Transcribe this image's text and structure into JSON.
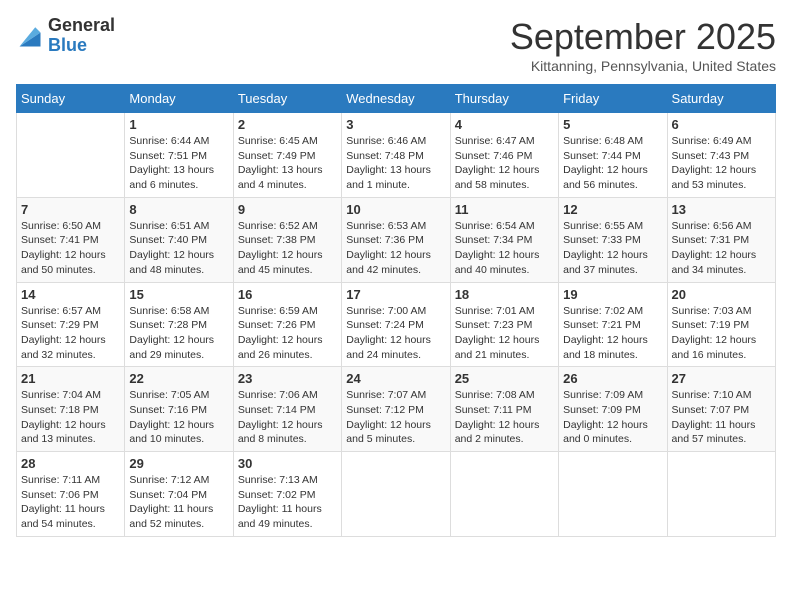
{
  "logo": {
    "general": "General",
    "blue": "Blue"
  },
  "title": "September 2025",
  "subtitle": "Kittanning, Pennsylvania, United States",
  "days_of_week": [
    "Sunday",
    "Monday",
    "Tuesday",
    "Wednesday",
    "Thursday",
    "Friday",
    "Saturday"
  ],
  "weeks": [
    [
      {
        "day": "",
        "info": ""
      },
      {
        "day": "1",
        "info": "Sunrise: 6:44 AM\nSunset: 7:51 PM\nDaylight: 13 hours\nand 6 minutes."
      },
      {
        "day": "2",
        "info": "Sunrise: 6:45 AM\nSunset: 7:49 PM\nDaylight: 13 hours\nand 4 minutes."
      },
      {
        "day": "3",
        "info": "Sunrise: 6:46 AM\nSunset: 7:48 PM\nDaylight: 13 hours\nand 1 minute."
      },
      {
        "day": "4",
        "info": "Sunrise: 6:47 AM\nSunset: 7:46 PM\nDaylight: 12 hours\nand 58 minutes."
      },
      {
        "day": "5",
        "info": "Sunrise: 6:48 AM\nSunset: 7:44 PM\nDaylight: 12 hours\nand 56 minutes."
      },
      {
        "day": "6",
        "info": "Sunrise: 6:49 AM\nSunset: 7:43 PM\nDaylight: 12 hours\nand 53 minutes."
      }
    ],
    [
      {
        "day": "7",
        "info": "Sunrise: 6:50 AM\nSunset: 7:41 PM\nDaylight: 12 hours\nand 50 minutes."
      },
      {
        "day": "8",
        "info": "Sunrise: 6:51 AM\nSunset: 7:40 PM\nDaylight: 12 hours\nand 48 minutes."
      },
      {
        "day": "9",
        "info": "Sunrise: 6:52 AM\nSunset: 7:38 PM\nDaylight: 12 hours\nand 45 minutes."
      },
      {
        "day": "10",
        "info": "Sunrise: 6:53 AM\nSunset: 7:36 PM\nDaylight: 12 hours\nand 42 minutes."
      },
      {
        "day": "11",
        "info": "Sunrise: 6:54 AM\nSunset: 7:34 PM\nDaylight: 12 hours\nand 40 minutes."
      },
      {
        "day": "12",
        "info": "Sunrise: 6:55 AM\nSunset: 7:33 PM\nDaylight: 12 hours\nand 37 minutes."
      },
      {
        "day": "13",
        "info": "Sunrise: 6:56 AM\nSunset: 7:31 PM\nDaylight: 12 hours\nand 34 minutes."
      }
    ],
    [
      {
        "day": "14",
        "info": "Sunrise: 6:57 AM\nSunset: 7:29 PM\nDaylight: 12 hours\nand 32 minutes."
      },
      {
        "day": "15",
        "info": "Sunrise: 6:58 AM\nSunset: 7:28 PM\nDaylight: 12 hours\nand 29 minutes."
      },
      {
        "day": "16",
        "info": "Sunrise: 6:59 AM\nSunset: 7:26 PM\nDaylight: 12 hours\nand 26 minutes."
      },
      {
        "day": "17",
        "info": "Sunrise: 7:00 AM\nSunset: 7:24 PM\nDaylight: 12 hours\nand 24 minutes."
      },
      {
        "day": "18",
        "info": "Sunrise: 7:01 AM\nSunset: 7:23 PM\nDaylight: 12 hours\nand 21 minutes."
      },
      {
        "day": "19",
        "info": "Sunrise: 7:02 AM\nSunset: 7:21 PM\nDaylight: 12 hours\nand 18 minutes."
      },
      {
        "day": "20",
        "info": "Sunrise: 7:03 AM\nSunset: 7:19 PM\nDaylight: 12 hours\nand 16 minutes."
      }
    ],
    [
      {
        "day": "21",
        "info": "Sunrise: 7:04 AM\nSunset: 7:18 PM\nDaylight: 12 hours\nand 13 minutes."
      },
      {
        "day": "22",
        "info": "Sunrise: 7:05 AM\nSunset: 7:16 PM\nDaylight: 12 hours\nand 10 minutes."
      },
      {
        "day": "23",
        "info": "Sunrise: 7:06 AM\nSunset: 7:14 PM\nDaylight: 12 hours\nand 8 minutes."
      },
      {
        "day": "24",
        "info": "Sunrise: 7:07 AM\nSunset: 7:12 PM\nDaylight: 12 hours\nand 5 minutes."
      },
      {
        "day": "25",
        "info": "Sunrise: 7:08 AM\nSunset: 7:11 PM\nDaylight: 12 hours\nand 2 minutes."
      },
      {
        "day": "26",
        "info": "Sunrise: 7:09 AM\nSunset: 7:09 PM\nDaylight: 12 hours\nand 0 minutes."
      },
      {
        "day": "27",
        "info": "Sunrise: 7:10 AM\nSunset: 7:07 PM\nDaylight: 11 hours\nand 57 minutes."
      }
    ],
    [
      {
        "day": "28",
        "info": "Sunrise: 7:11 AM\nSunset: 7:06 PM\nDaylight: 11 hours\nand 54 minutes."
      },
      {
        "day": "29",
        "info": "Sunrise: 7:12 AM\nSunset: 7:04 PM\nDaylight: 11 hours\nand 52 minutes."
      },
      {
        "day": "30",
        "info": "Sunrise: 7:13 AM\nSunset: 7:02 PM\nDaylight: 11 hours\nand 49 minutes."
      },
      {
        "day": "",
        "info": ""
      },
      {
        "day": "",
        "info": ""
      },
      {
        "day": "",
        "info": ""
      },
      {
        "day": "",
        "info": ""
      }
    ]
  ]
}
